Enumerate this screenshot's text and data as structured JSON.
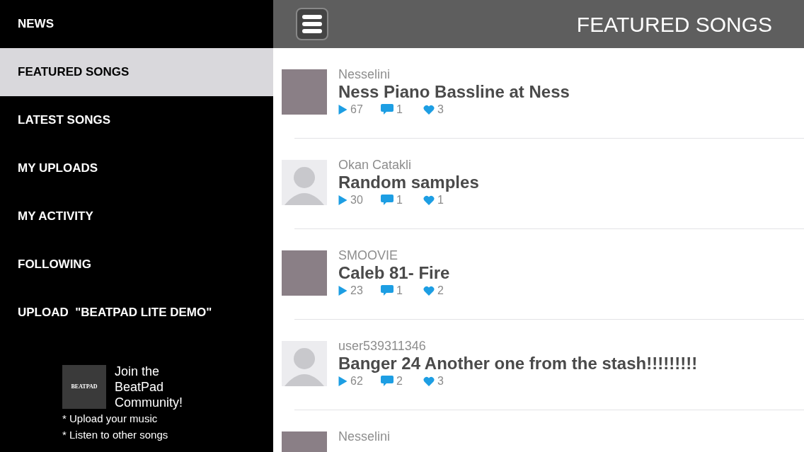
{
  "sidebar": {
    "items": [
      {
        "label": "NEWS",
        "selected": false
      },
      {
        "label": "FEATURED SONGS",
        "selected": true
      },
      {
        "label": "LATEST SONGS",
        "selected": false
      },
      {
        "label": "MY UPLOADS",
        "selected": false
      },
      {
        "label": "MY ACTIVITY",
        "selected": false
      },
      {
        "label": "FOLLOWING",
        "selected": false
      },
      {
        "label": "UPLOAD  \"BEATPAD LITE DEMO\"",
        "selected": false
      }
    ],
    "promo": {
      "logo_text": "BEATPAD",
      "title": "Join the BeatPad Community!",
      "bullets": [
        "* Upload your music",
        "* Listen to other songs"
      ]
    }
  },
  "header": {
    "title": "FEATURED SONGS"
  },
  "songs": [
    {
      "user": "Nesselini",
      "title": "Ness Piano Bassline at Ness",
      "plays": "67",
      "comments": "1",
      "likes": "3",
      "kind": "photo"
    },
    {
      "user": "Okan Catakli",
      "title": "Random samples",
      "plays": "30",
      "comments": "1",
      "likes": "1",
      "kind": "default"
    },
    {
      "user": "SMOOVIE",
      "title": "Caleb 81- Fire",
      "plays": "23",
      "comments": "1",
      "likes": "2",
      "kind": "photo"
    },
    {
      "user": "user539311346",
      "title": "Banger 24 Another one from the stash!!!!!!!!!",
      "plays": "62",
      "comments": "2",
      "likes": "3",
      "kind": "default"
    },
    {
      "user": "Nesselini",
      "kind": "photo"
    }
  ]
}
